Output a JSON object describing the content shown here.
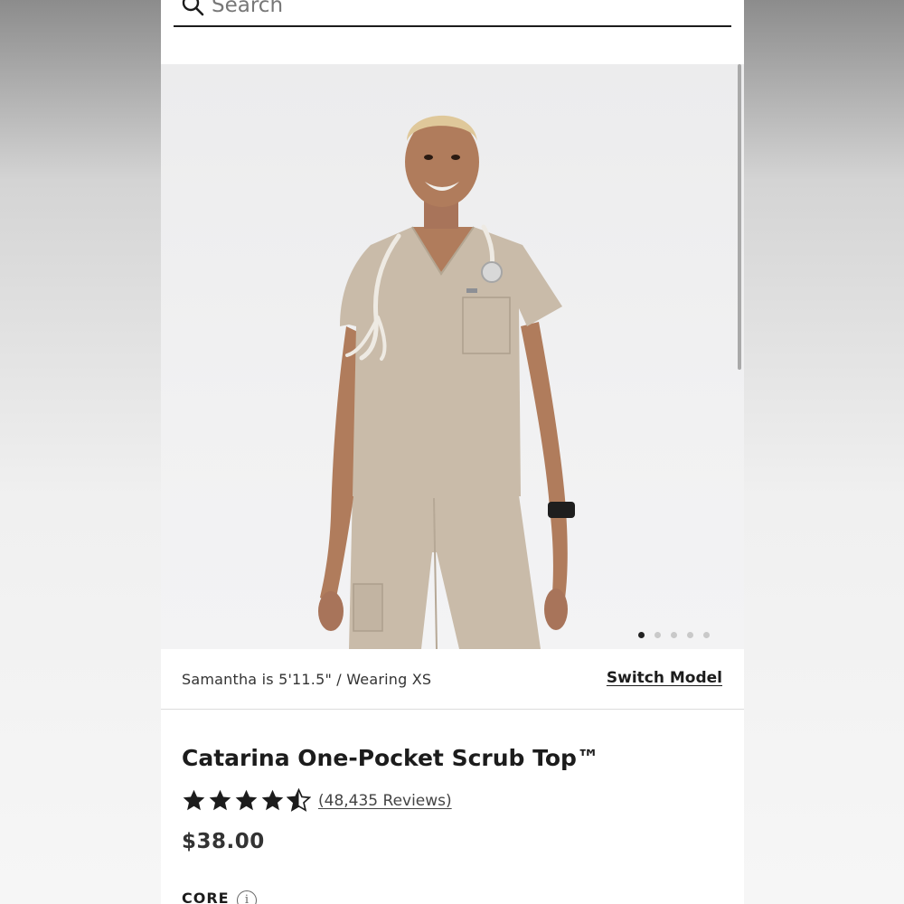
{
  "search": {
    "placeholder": "Search"
  },
  "gallery": {
    "active_index": 0,
    "dot_count": 5
  },
  "model_info": {
    "text": "Samantha is 5'11.5\" / Wearing XS",
    "switch_label": "Switch Model"
  },
  "product": {
    "title": "Catarina One-Pocket Scrub Top™",
    "rating": 4.5,
    "reviews_label": "(48,435 Reviews)",
    "price": "$38.00",
    "collection": "CORE",
    "info_glyph": "i"
  },
  "colors": {
    "scrub": "#c9bba9",
    "text": "#1c1c1c",
    "background": "#ffffff"
  },
  "icons": [
    "search-icon",
    "star-icon",
    "info-icon",
    "stethoscope",
    "smartwatch"
  ]
}
